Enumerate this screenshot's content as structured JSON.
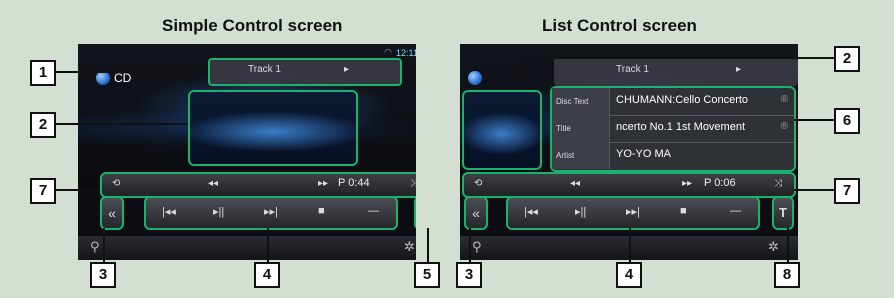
{
  "titles": {
    "simple": "Simple Control screen",
    "list": "List Control screen"
  },
  "simple": {
    "source": "CD",
    "clock": "12:11",
    "track": "Track  1",
    "time": "P 0:44"
  },
  "list": {
    "track": "Track  1",
    "time": "P 0:06",
    "info": [
      {
        "key": "Disc Text",
        "value": "CHUMANN:Cello Concerto"
      },
      {
        "key": "Title",
        "value": "ncerto No.1 1st Movement"
      },
      {
        "key": "Artist",
        "value": "YO-YO MA"
      }
    ]
  },
  "callouts": {
    "simple": [
      "1",
      "2",
      "7",
      "3",
      "4",
      "5"
    ],
    "list": [
      "2",
      "6",
      "7",
      "3",
      "4",
      "8"
    ]
  },
  "icons": {
    "repeat": "⟲",
    "rewind": "◂◂",
    "forward": "▸▸",
    "shuffle": "⤨",
    "collapse": "«",
    "prev": "|◂◂",
    "playpause": "▸||",
    "next": "▸▸|",
    "stop": "■",
    "minus": "—",
    "mode": "T",
    "play": "▸",
    "search": "⚲",
    "settings": "✲",
    "info": "®"
  },
  "colors": {
    "accent": "#19b36b",
    "background": "#d2dfd2"
  }
}
